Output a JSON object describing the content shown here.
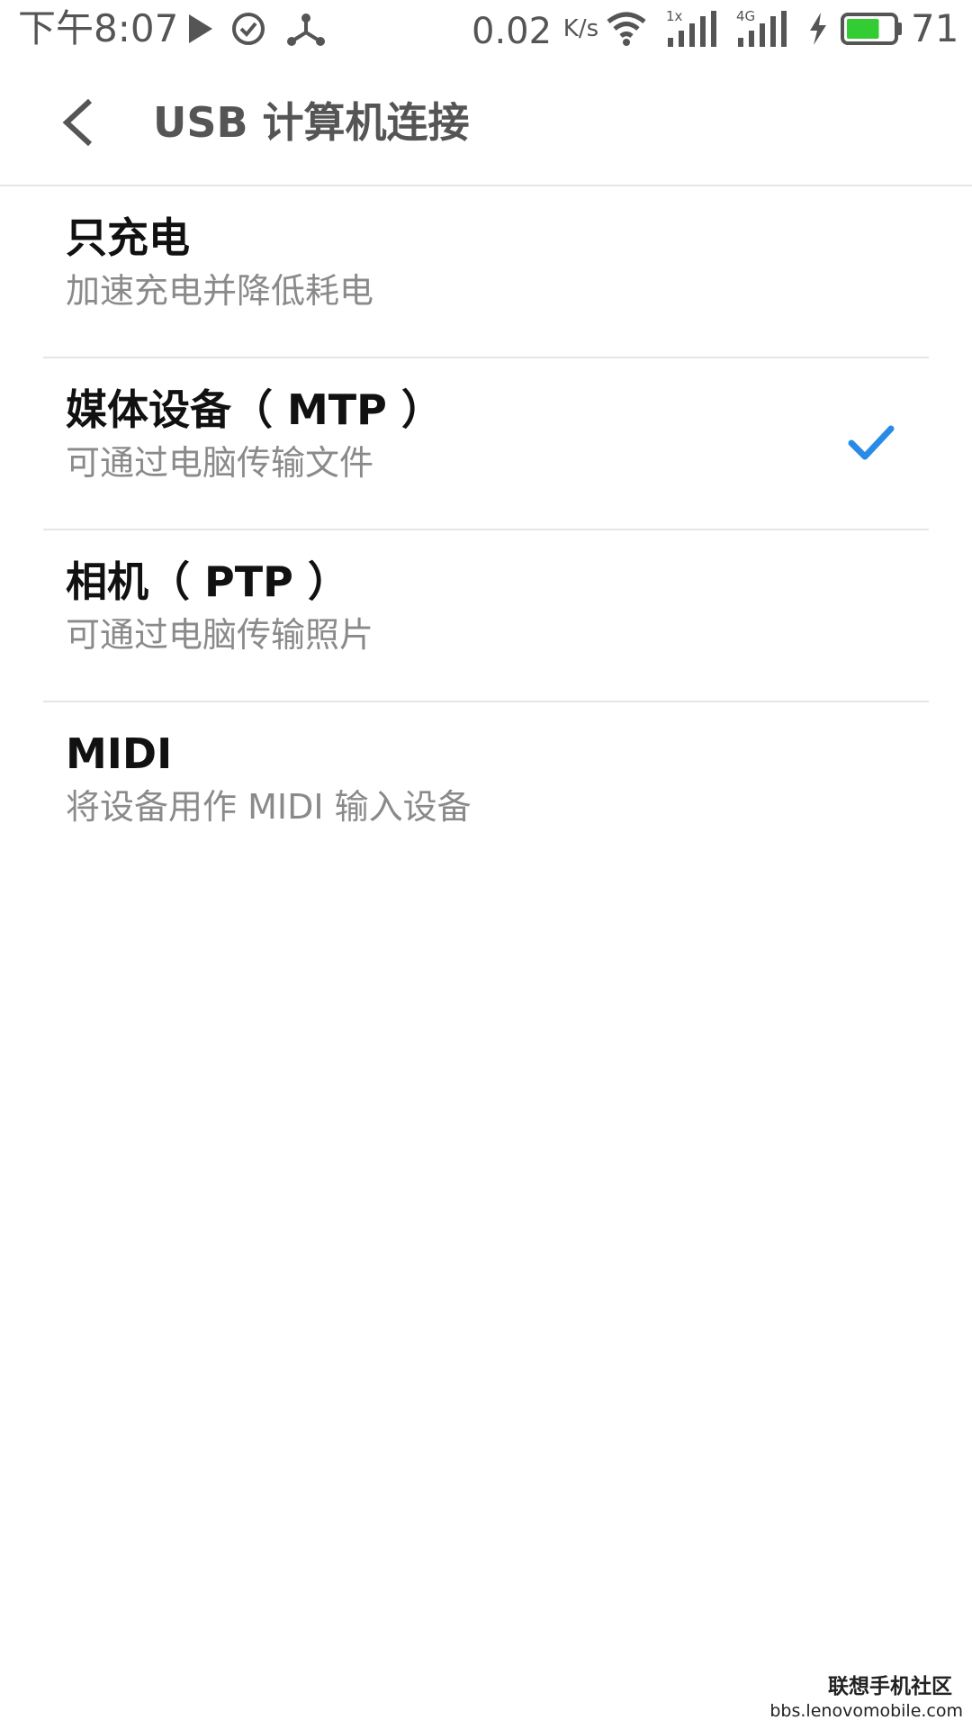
{
  "status_bar": {
    "time": "下午8:07",
    "net_speed_value": "0.02",
    "net_speed_unit": "K/s",
    "signal1_label": "1x",
    "signal2_label": "4G",
    "battery_percent": "71",
    "battery_fill": 0.71,
    "battery_color": "#33cc33",
    "icons": [
      "play-icon",
      "check-circle-icon",
      "usb-share-icon",
      "wifi-icon",
      "signal-1x-icon",
      "signal-4g-icon",
      "charging-bolt-icon",
      "battery-icon"
    ]
  },
  "header": {
    "title": "USB 计算机连接",
    "back_icon": "chevron-left-icon"
  },
  "options": [
    {
      "title": "只充电",
      "subtitle": "加速充电并降低耗电",
      "selected": false
    },
    {
      "title": "媒体设备（ MTP ）",
      "subtitle": "可通过电脑传输文件",
      "selected": true
    },
    {
      "title": "相机（ PTP ）",
      "subtitle": "可通过电脑传输照片",
      "selected": false
    },
    {
      "title": "MIDI",
      "subtitle": "将设备用作 MIDI 输入设备",
      "selected": false
    }
  ],
  "accent_color": "#2a8be6",
  "watermark": {
    "title": "联想手机社区",
    "url": "bbs.lenovomobile.com"
  }
}
